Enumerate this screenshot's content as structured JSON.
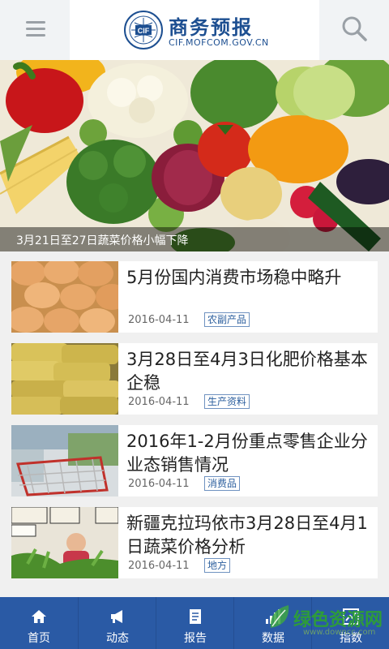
{
  "header": {
    "title": "商务预报",
    "url": "CIF.MOFCOM.GOV.CN",
    "logo_text": "CIF"
  },
  "banner": {
    "caption": "3月21日至27日蔬菜价格小幅下降",
    "dot_count": 4,
    "active_dot": 0
  },
  "news": [
    {
      "title": "5月份国内消费市场稳中略升",
      "date": "2016-04-11",
      "tag": "农副产品",
      "image": "eggs-photo"
    },
    {
      "title": "3月28日至4月3日化肥价格基本企稳",
      "date": "2016-04-11",
      "tag": "生产资料",
      "image": "fertilizer-bags-photo"
    },
    {
      "title": "2016年1-2月份重点零售企业分业态销售情况",
      "date": "2016-04-11",
      "tag": "消费品",
      "image": "shopping-cart-photo"
    },
    {
      "title": "新疆克拉玛依市3月28日至4月1日蔬菜价格分析",
      "date": "2016-04-11",
      "tag": "地方",
      "image": "vegetable-market-photo"
    }
  ],
  "nav": [
    {
      "label": "首页",
      "icon": "home-icon"
    },
    {
      "label": "动态",
      "icon": "megaphone-icon"
    },
    {
      "label": "报告",
      "icon": "document-icon"
    },
    {
      "label": "数据",
      "icon": "bar-chart-icon"
    },
    {
      "label": "指数",
      "icon": "trend-chart-icon"
    }
  ],
  "watermark": {
    "text": "绿色资源网",
    "url": "www.downcc.com"
  },
  "colors": {
    "brand": "#1d4f91",
    "nav_bg": "#2a5aa5",
    "tag": "#2c5f9e"
  }
}
